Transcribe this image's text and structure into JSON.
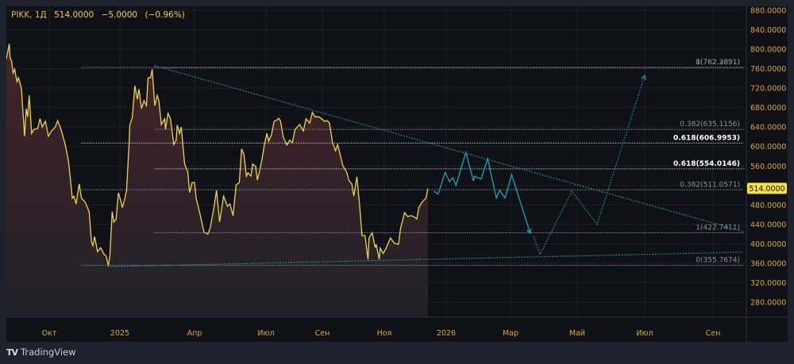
{
  "header": {
    "symbol": "PIKK, 1Д",
    "last": "514.0000",
    "change": "−5.0000",
    "change_pct": "(−0.96%)"
  },
  "branding": {
    "logo_text": "TradingView"
  },
  "colors": {
    "price_line": "#e8d44d",
    "area_top": "#43252a",
    "projection": "#1aa6b7",
    "axis_text": "#d9a83a",
    "price_tag": "#f5e33a",
    "background": "#0f1116"
  },
  "chart_data": {
    "type": "area",
    "ylim": [
      260,
      890
    ],
    "yticks": [
      "880.0000",
      "840.0000",
      "800.0000",
      "760.0000",
      "720.0000",
      "680.0000",
      "640.0000",
      "600.0000",
      "560.0000",
      "520.0000",
      "480.0000",
      "440.0000",
      "400.0000",
      "360.0000",
      "320.0000",
      "280.0000"
    ],
    "xticks": [
      {
        "label": "Окт",
        "date": "2024-10-01"
      },
      {
        "label": "2025",
        "date": "2025-01-01"
      },
      {
        "label": "Апр",
        "date": "2025-04-01"
      },
      {
        "label": "Июл",
        "date": "2025-07-01"
      },
      {
        "label": "Сен",
        "date": "2025-09-01"
      },
      {
        "label": "Ноя",
        "date": "2025-11-01"
      },
      {
        "label": "2026",
        "date": "2026-01-01"
      },
      {
        "label": "Мар",
        "date": "2026-03-01"
      },
      {
        "label": "Май",
        "date": "2026-05-01"
      },
      {
        "label": "Июл",
        "date": "2026-07-01"
      },
      {
        "label": "Сен",
        "date": "2026-09-01"
      }
    ],
    "grid": true,
    "current_price_label": "514.0000",
    "series": [
      {
        "points": [
          [
            "2024-08-06",
            779
          ],
          [
            "2024-08-10",
            811
          ],
          [
            "2024-08-11",
            782
          ],
          [
            "2024-08-13",
            776
          ],
          [
            "2024-08-15",
            751
          ],
          [
            "2024-08-17",
            759
          ],
          [
            "2024-08-20",
            733
          ],
          [
            "2024-08-22",
            741
          ],
          [
            "2024-08-26",
            718
          ],
          [
            "2024-08-27",
            689
          ],
          [
            "2024-08-30",
            621
          ],
          [
            "2024-09-01",
            678
          ],
          [
            "2024-09-03",
            661
          ],
          [
            "2024-09-05",
            705
          ],
          [
            "2024-09-08",
            627
          ],
          [
            "2024-09-11",
            635
          ],
          [
            "2024-09-16",
            637
          ],
          [
            "2024-09-19",
            657
          ],
          [
            "2024-09-22",
            640
          ],
          [
            "2024-09-26",
            652
          ],
          [
            "2024-09-30",
            621
          ],
          [
            "2024-10-04",
            632
          ],
          [
            "2024-10-09",
            640
          ],
          [
            "2024-10-12",
            653
          ],
          [
            "2024-10-16",
            637
          ],
          [
            "2024-10-22",
            603
          ],
          [
            "2024-10-26",
            570
          ],
          [
            "2024-10-28",
            542
          ],
          [
            "2024-10-31",
            494
          ],
          [
            "2024-11-02",
            498
          ],
          [
            "2024-11-05",
            482
          ],
          [
            "2024-11-09",
            523
          ],
          [
            "2024-11-12",
            494
          ],
          [
            "2024-11-17",
            485
          ],
          [
            "2024-11-22",
            466
          ],
          [
            "2024-11-25",
            404
          ],
          [
            "2024-11-27",
            396
          ],
          [
            "2024-11-29",
            415
          ],
          [
            "2024-12-03",
            384
          ],
          [
            "2024-12-07",
            392
          ],
          [
            "2024-12-11",
            379
          ],
          [
            "2024-12-14",
            375
          ],
          [
            "2024-12-17",
            355
          ],
          [
            "2024-12-19",
            375
          ],
          [
            "2024-12-22",
            466
          ],
          [
            "2024-12-24",
            445
          ],
          [
            "2024-12-27",
            450
          ],
          [
            "2024-12-30",
            505
          ],
          [
            "2025-01-02",
            489
          ],
          [
            "2025-01-04",
            474
          ],
          [
            "2025-01-07",
            494
          ],
          [
            "2025-01-09",
            510
          ],
          [
            "2025-01-12",
            603
          ],
          [
            "2025-01-13",
            644
          ],
          [
            "2025-01-16",
            660
          ],
          [
            "2025-01-19",
            725
          ],
          [
            "2025-01-22",
            697
          ],
          [
            "2025-01-24",
            718
          ],
          [
            "2025-01-27",
            678
          ],
          [
            "2025-01-30",
            694
          ],
          [
            "2025-02-02",
            684
          ],
          [
            "2025-02-04",
            741
          ],
          [
            "2025-02-07",
            741
          ],
          [
            "2025-02-09",
            759
          ],
          [
            "2025-02-12",
            684
          ],
          [
            "2025-02-15",
            705
          ],
          [
            "2025-02-17",
            694
          ],
          [
            "2025-02-20",
            645
          ],
          [
            "2025-02-24",
            657
          ],
          [
            "2025-02-25",
            635
          ],
          [
            "2025-02-28",
            668
          ],
          [
            "2025-03-03",
            657
          ],
          [
            "2025-03-07",
            604
          ],
          [
            "2025-03-10",
            613
          ],
          [
            "2025-03-11",
            644
          ],
          [
            "2025-03-14",
            627
          ],
          [
            "2025-03-16",
            640
          ],
          [
            "2025-03-20",
            564
          ],
          [
            "2025-03-24",
            547
          ],
          [
            "2025-03-26",
            505
          ],
          [
            "2025-03-29",
            526
          ],
          [
            "2025-04-01",
            526
          ],
          [
            "2025-04-03",
            494
          ],
          [
            "2025-04-08",
            461
          ],
          [
            "2025-04-13",
            424
          ],
          [
            "2025-04-18",
            420
          ],
          [
            "2025-04-21",
            433
          ],
          [
            "2025-04-26",
            477
          ],
          [
            "2025-04-29",
            510
          ],
          [
            "2025-05-03",
            445
          ],
          [
            "2025-05-08",
            498
          ],
          [
            "2025-05-13",
            477
          ],
          [
            "2025-05-16",
            482
          ],
          [
            "2025-05-20",
            458
          ],
          [
            "2025-05-24",
            521
          ],
          [
            "2025-05-28",
            526
          ],
          [
            "2025-05-31",
            595
          ],
          [
            "2025-06-03",
            583
          ],
          [
            "2025-06-06",
            539
          ],
          [
            "2025-06-08",
            546
          ],
          [
            "2025-06-12",
            539
          ],
          [
            "2025-06-14",
            564
          ],
          [
            "2025-06-18",
            559
          ],
          [
            "2025-06-20",
            531
          ],
          [
            "2025-06-23",
            551
          ],
          [
            "2025-06-26",
            575
          ],
          [
            "2025-06-29",
            604
          ],
          [
            "2025-07-02",
            627
          ],
          [
            "2025-07-04",
            611
          ],
          [
            "2025-07-07",
            624
          ],
          [
            "2025-07-10",
            652
          ],
          [
            "2025-07-12",
            653
          ],
          [
            "2025-07-15",
            658
          ],
          [
            "2025-07-17",
            652
          ],
          [
            "2025-07-20",
            619
          ],
          [
            "2025-07-24",
            603
          ],
          [
            "2025-07-27",
            613
          ],
          [
            "2025-07-30",
            608
          ],
          [
            "2025-08-02",
            635
          ],
          [
            "2025-08-07",
            645
          ],
          [
            "2025-08-11",
            632
          ],
          [
            "2025-08-14",
            657
          ],
          [
            "2025-08-18",
            648
          ],
          [
            "2025-08-21",
            670
          ],
          [
            "2025-08-24",
            661
          ],
          [
            "2025-08-28",
            661
          ],
          [
            "2025-08-31",
            657
          ],
          [
            "2025-09-03",
            652
          ],
          [
            "2025-09-06",
            653
          ],
          [
            "2025-09-08",
            648
          ],
          [
            "2025-09-11",
            608
          ],
          [
            "2025-09-14",
            591
          ],
          [
            "2025-09-16",
            604
          ],
          [
            "2025-09-18",
            588
          ],
          [
            "2025-09-21",
            562
          ],
          [
            "2025-09-23",
            554
          ],
          [
            "2025-09-25",
            547
          ],
          [
            "2025-09-27",
            531
          ],
          [
            "2025-09-30",
            523
          ],
          [
            "2025-10-02",
            498
          ],
          [
            "2025-10-05",
            538
          ],
          [
            "2025-10-08",
            472
          ],
          [
            "2025-10-10",
            417
          ],
          [
            "2025-10-13",
            417
          ],
          [
            "2025-10-16",
            368
          ],
          [
            "2025-10-17",
            412
          ],
          [
            "2025-10-20",
            423
          ],
          [
            "2025-10-23",
            392
          ],
          [
            "2025-10-24",
            399
          ],
          [
            "2025-10-27",
            368
          ],
          [
            "2025-10-28",
            391
          ],
          [
            "2025-10-31",
            380
          ],
          [
            "2025-11-03",
            392
          ],
          [
            "2025-11-07",
            412
          ],
          [
            "2025-11-11",
            401
          ],
          [
            "2025-11-15",
            399
          ],
          [
            "2025-11-17",
            432
          ],
          [
            "2025-11-21",
            464
          ],
          [
            "2025-11-24",
            456
          ],
          [
            "2025-11-27",
            458
          ],
          [
            "2025-11-30",
            456
          ],
          [
            "2025-12-03",
            451
          ],
          [
            "2025-12-05",
            474
          ],
          [
            "2025-12-08",
            485
          ],
          [
            "2025-12-12",
            494
          ],
          [
            "2025-12-14",
            514
          ]
        ]
      }
    ],
    "drawings": {
      "projection_solid": [
        [
          "2025-12-20",
          508
        ],
        [
          "2025-12-24",
          502
        ],
        [
          "2025-12-31",
          547
        ],
        [
          "2026-01-04",
          528
        ],
        [
          "2026-01-07",
          536
        ],
        [
          "2026-01-10",
          520
        ],
        [
          "2026-01-19",
          588
        ],
        [
          "2026-01-26",
          529
        ],
        [
          "2026-01-27",
          539
        ],
        [
          "2026-02-02",
          533
        ],
        [
          "2026-02-08",
          575
        ],
        [
          "2026-02-16",
          494
        ],
        [
          "2026-02-19",
          510
        ],
        [
          "2026-02-24",
          494
        ],
        [
          "2026-03-02",
          542
        ],
        [
          "2026-03-19",
          422
        ]
      ],
      "projection_dotted": [
        [
          "2026-03-22",
          415
        ],
        [
          "2026-03-28",
          378
        ],
        [
          "2026-04-26",
          508
        ],
        [
          "2026-05-19",
          440
        ],
        [
          "2026-07-01",
          746
        ]
      ],
      "trendlines": [
        [
          [
            "2025-02-12",
            766
          ],
          [
            "2026-09-29",
            425
          ]
        ],
        [
          [
            "2024-12-16",
            353
          ],
          [
            "2026-09-29",
            383
          ]
        ]
      ],
      "fib_levels": [
        {
          "label": "0(762.3891)",
          "value": 762.3891,
          "start": "2024-11-12",
          "bold": false
        },
        {
          "label": "1(762.2891)",
          "value": 762.3891,
          "start": "2025-02-12",
          "bold": false
        },
        {
          "label": "0.382(635.1156)",
          "value": 635.1156,
          "start": "2025-02-12",
          "bold": false
        },
        {
          "label": "0.618(606.9953)",
          "value": 606.9953,
          "start": "2024-11-12",
          "bold": true
        },
        {
          "label": "0.618(554.0146)",
          "value": 554.0146,
          "start": "2025-02-12",
          "bold": true
        },
        {
          "label": "0.382(511.0571)",
          "value": 511.0571,
          "start": "2024-11-12",
          "bold": false
        },
        {
          "label": "1(422.7411)",
          "value": 422.7411,
          "start": "2025-02-12",
          "bold": false
        },
        {
          "label": "0(355.7674)",
          "value": 355.7674,
          "start": "2024-11-12",
          "bold": false
        }
      ],
      "fib_end": "2026-09-29"
    }
  }
}
